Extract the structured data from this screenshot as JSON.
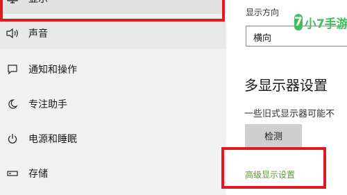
{
  "sidebar": {
    "items": [
      {
        "label": "显示",
        "icon": "monitor-icon"
      },
      {
        "label": "声音",
        "icon": "speaker-icon"
      },
      {
        "label": "通知和操作",
        "icon": "notification-icon"
      },
      {
        "label": "专注助手",
        "icon": "moon-icon"
      },
      {
        "label": "电源和睡眠",
        "icon": "power-icon"
      },
      {
        "label": "存储",
        "icon": "storage-icon"
      }
    ]
  },
  "content": {
    "orientation_label": "显示方向",
    "orientation_value": "横向",
    "multi_display_title": "多显示器设置",
    "multi_display_desc": "一些旧式显示器可能不",
    "detect_label": "检测",
    "advanced_link": "高级显示设置"
  },
  "watermark": {
    "badge": "7",
    "text": "小7手游"
  },
  "colors": {
    "highlight": "#e01a22",
    "link": "#5c9a3d",
    "watermark": "#3fbf5b",
    "sidebar_bg": "#f1f1f1"
  }
}
